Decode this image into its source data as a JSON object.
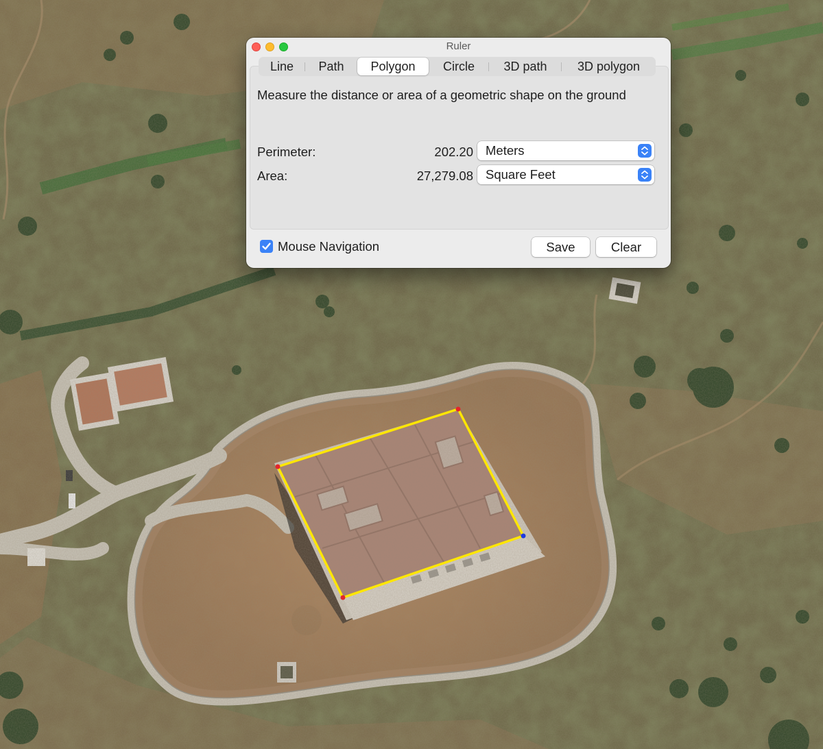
{
  "window": {
    "title": "Ruler"
  },
  "tabs": [
    {
      "label": "Line"
    },
    {
      "label": "Path"
    },
    {
      "label": "Polygon"
    },
    {
      "label": "Circle"
    },
    {
      "label": "3D path"
    },
    {
      "label": "3D polygon"
    }
  ],
  "active_tab": "Polygon",
  "description": "Measure the distance or area of a geometric shape on the ground",
  "measurements": {
    "perimeter": {
      "label": "Perimeter:",
      "value": "202.20",
      "unit": "Meters"
    },
    "area": {
      "label": "Area:",
      "value": "27,279.08",
      "unit": "Square Feet"
    }
  },
  "mouse_navigation": {
    "label": "Mouse Navigation",
    "checked": true
  },
  "buttons": {
    "save": "Save",
    "clear": "Clear"
  },
  "colors": {
    "accent": "#3a82f7",
    "polygon_outline": "#ffe600",
    "vertex_red": "#e3262b",
    "vertex_blue": "#1e3be0"
  },
  "map": {
    "type": "satellite imagery",
    "polygon_vertices_visible": 4
  }
}
